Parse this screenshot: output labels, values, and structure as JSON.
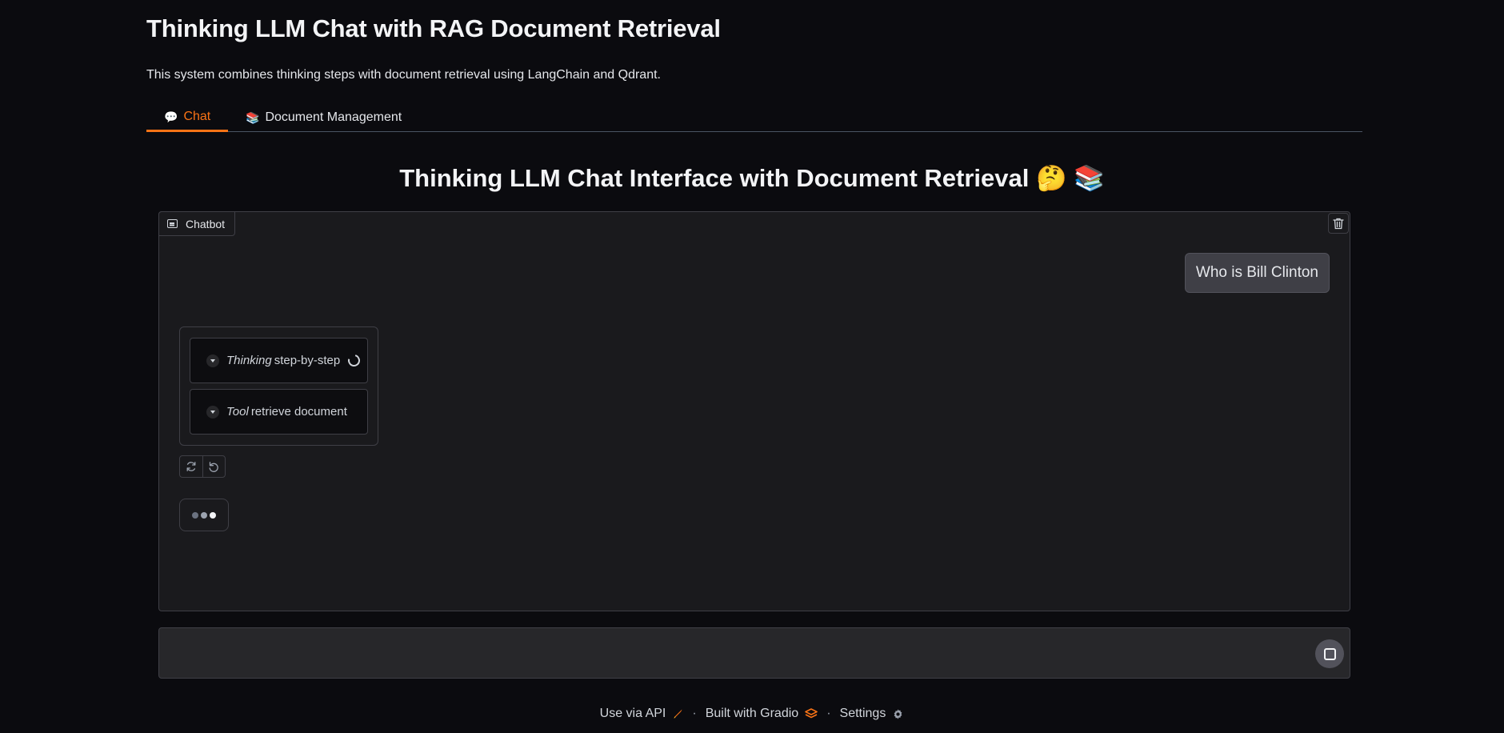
{
  "header": {
    "title": "Thinking LLM Chat with RAG Document Retrieval",
    "subtitle": "This system combines thinking steps with document retrieval using LangChain and Qdrant."
  },
  "tabs": [
    {
      "icon": "💬",
      "label": "Chat",
      "active": true
    },
    {
      "icon": "📚",
      "label": "Document Management",
      "active": false
    }
  ],
  "chat": {
    "heading": "Thinking LLM Chat Interface with Document Retrieval 🤔 📚",
    "panel_label": "Chatbot",
    "user_message": "Who is Bill Clinton",
    "bot_steps": [
      {
        "kind": "Thinking",
        "text": "step-by-step",
        "loading": true
      },
      {
        "kind": "Tool",
        "text": "retrieve document",
        "loading": false
      }
    ]
  },
  "input": {
    "value": "",
    "placeholder": ""
  },
  "footer": {
    "api_label": "Use via API",
    "built_label": "Built with Gradio",
    "settings_label": "Settings",
    "separator": "·"
  },
  "colors": {
    "accent": "#f97316",
    "background": "#0b0b0f",
    "panel": "#1a1a1d"
  }
}
